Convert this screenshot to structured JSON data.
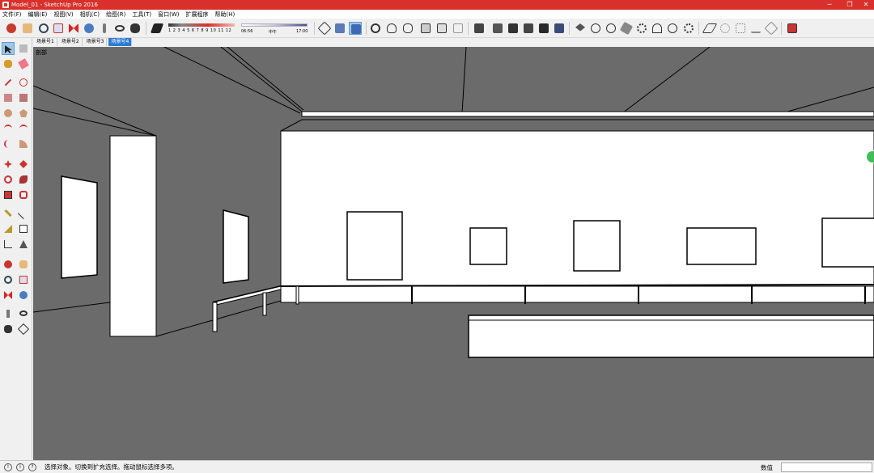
{
  "window": {
    "title": "Model_01 - SketchUp Pro 2016",
    "controls": {
      "minimize": "─",
      "maximize": "❐",
      "close": "✕"
    }
  },
  "menu": [
    "文件(F)",
    "编辑(E)",
    "视图(V)",
    "相机(C)",
    "绘图(R)",
    "工具(T)",
    "窗口(W)",
    "扩展程序",
    "帮助(H)"
  ],
  "shadow_settings": {
    "month_scale": "1 2 3 4 5 6 7 8 9 10 11 12",
    "time_start": "06:56",
    "time_mid": "中午",
    "time_end": "17:00"
  },
  "scene_tabs": [
    {
      "label": "场景号1",
      "active": false
    },
    {
      "label": "场景号2",
      "active": false
    },
    {
      "label": "场景号3",
      "active": false
    },
    {
      "label": "场景号4",
      "active": true
    }
  ],
  "viewport": {
    "label": "剖部",
    "background": "#6b6b6b"
  },
  "status": {
    "message": "选择对象。切换到扩充选择。拖动鼠标选择多项。",
    "value_label": "数值",
    "value": ""
  },
  "colors": {
    "titlebar": "#d9302b",
    "accent": "#2d7bd4"
  }
}
